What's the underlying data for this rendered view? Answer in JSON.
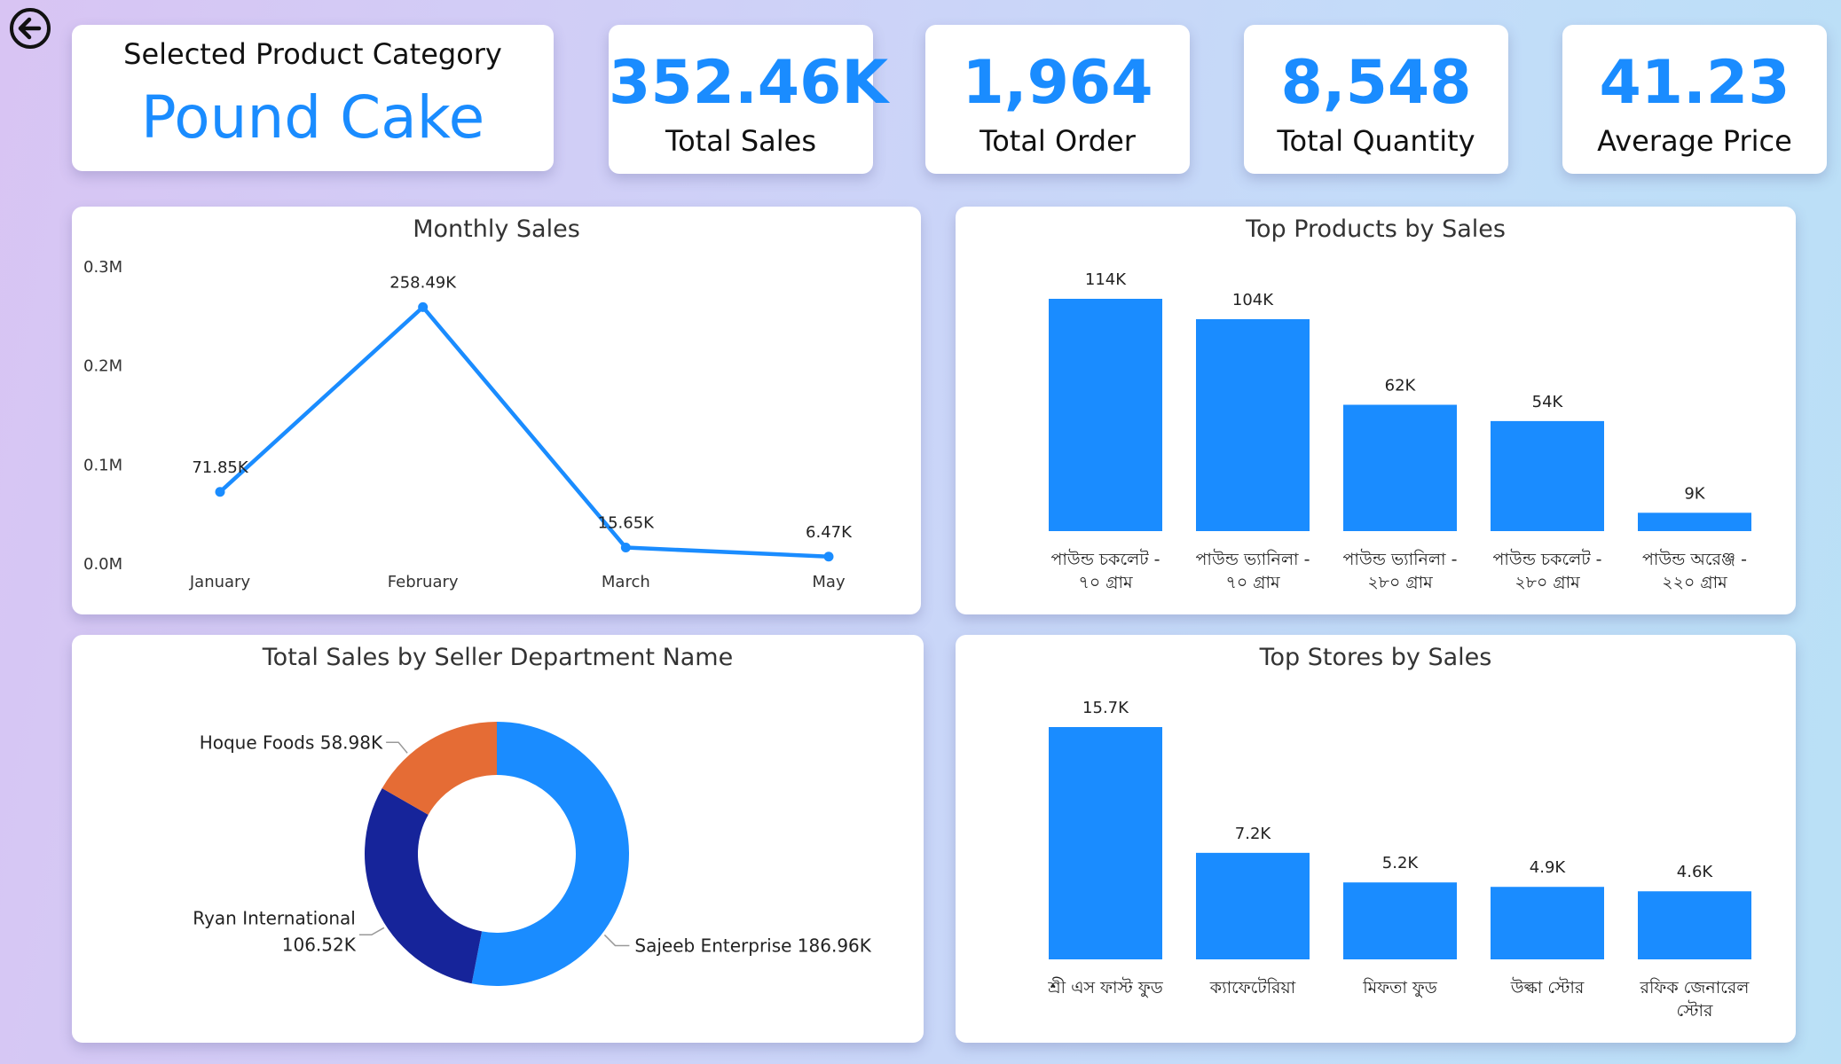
{
  "header": {
    "back_icon": "arrow-left-circle-icon",
    "category_title": "Selected Product Category",
    "category_value": "Pound Cake"
  },
  "kpis": [
    {
      "value": "352.46K",
      "label": "Total Sales"
    },
    {
      "value": "1,964",
      "label": "Total Order"
    },
    {
      "value": "8,548",
      "label": "Total Quantity"
    },
    {
      "value": "41.23",
      "label": "Average Price"
    }
  ],
  "colors": {
    "accent": "#1a8cff",
    "navy": "#16249a",
    "orange": "#e56c35"
  },
  "chart_data": [
    {
      "type": "line",
      "title": "Monthly Sales",
      "categories": [
        "January",
        "February",
        "March",
        "May"
      ],
      "values": [
        71850,
        258490,
        15650,
        6470
      ],
      "data_labels": [
        "71.85K",
        "258.49K",
        "15.65K",
        "6.47K"
      ],
      "ylim": [
        0,
        300000
      ],
      "y_ticks": [
        0,
        100000,
        200000,
        300000
      ],
      "y_tick_labels": [
        "0.0M",
        "0.1M",
        "0.2M",
        "0.3M"
      ],
      "grid": false
    },
    {
      "type": "bar",
      "title": "Top Products by Sales",
      "categories": [
        [
          "পাউন্ড চকলেট -",
          "৭০ গ্রাম"
        ],
        [
          "পাউন্ড ভ্যানিলা -",
          "৭০ গ্রাম"
        ],
        [
          "পাউন্ড ভ্যানিলা -",
          "২৮০ গ্রাম"
        ],
        [
          "পাউন্ড চকলেট -",
          "২৮০ গ্রাম"
        ],
        [
          "পাউন্ড অরেঞ্জ -",
          "২২০ গ্রাম"
        ]
      ],
      "values": [
        114000,
        104000,
        62000,
        54000,
        9000
      ],
      "data_labels": [
        "114K",
        "104K",
        "62K",
        "54K",
        "9K"
      ]
    },
    {
      "type": "pie",
      "title": "Total Sales by Seller Department Name",
      "slices": [
        {
          "name": "Sajeeb Enterprise",
          "value": 186960,
          "label": "Sajeeb Enterprise 186.96K",
          "color": "#1a8cff"
        },
        {
          "name": "Ryan International",
          "value": 106520,
          "label_lines": [
            "Ryan International",
            "106.52K"
          ],
          "color": "#16249a"
        },
        {
          "name": "Hoque Foods",
          "value": 58980,
          "label": "Hoque Foods 58.98K",
          "color": "#e56c35"
        }
      ]
    },
    {
      "type": "bar",
      "title": "Top Stores by Sales",
      "categories": [
        [
          "শ্রী এস ফাস্ট ফুড"
        ],
        [
          "ক্যাফেটেরিয়া"
        ],
        [
          "মিফতা ফুড"
        ],
        [
          "উল্কা স্টোর"
        ],
        [
          "রফিক জেনারেল",
          "স্টোর"
        ]
      ],
      "values": [
        15700,
        7200,
        5200,
        4900,
        4600
      ],
      "data_labels": [
        "15.7K",
        "7.2K",
        "5.2K",
        "4.9K",
        "4.6K"
      ]
    }
  ]
}
